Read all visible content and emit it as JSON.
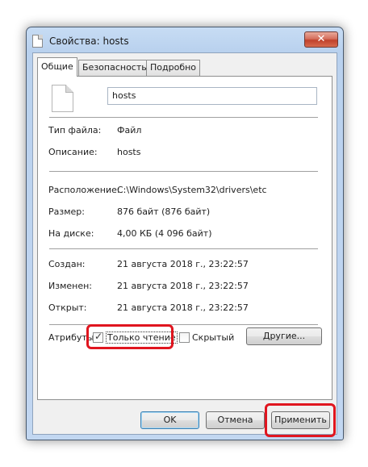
{
  "window": {
    "title": "Свойства: hosts",
    "close_label": "✕"
  },
  "tabs": [
    {
      "label": "Общие",
      "active": true
    },
    {
      "label": "Безопасность",
      "active": false
    },
    {
      "label": "Подробно",
      "active": false
    }
  ],
  "file": {
    "name": "hosts",
    "icon": "file-icon"
  },
  "info": {
    "type_label": "Тип файла:",
    "type_value": "Файл",
    "desc_label": "Описание:",
    "desc_value": "hosts",
    "location_label": "Расположение:",
    "location_value": "C:\\Windows\\System32\\drivers\\etc",
    "size_label": "Размер:",
    "size_value": "876 байт (876 байт)",
    "disk_label": "На диске:",
    "disk_value": "4,00 КБ (4 096 байт)",
    "created_label": "Создан:",
    "created_value": "21 августа 2018 г., 23:22:57",
    "modified_label": "Изменен:",
    "modified_value": "21 августа 2018 г., 23:22:57",
    "opened_label": "Открыт:",
    "opened_value": "21 августа 2018 г., 23:22:57"
  },
  "attributes": {
    "label": "Атрибуты:",
    "readonly_label": "Только чтение",
    "readonly_checked": true,
    "hidden_label": "Скрытый",
    "hidden_checked": false,
    "other_button": "Другие..."
  },
  "buttons": {
    "ok": "OK",
    "cancel": "Отмена",
    "apply": "Применить"
  },
  "colors": {
    "highlight": "#e0151f",
    "title_bar": "#b9d1ee"
  }
}
